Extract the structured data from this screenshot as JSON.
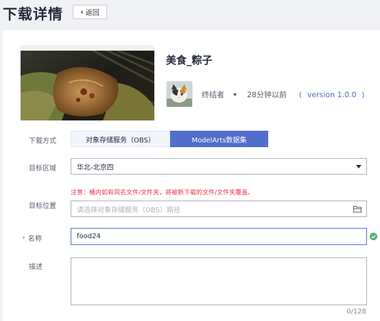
{
  "page": {
    "title": "下载详情",
    "back_label": "返回"
  },
  "dataset": {
    "title": "美食_粽子",
    "owner": "终结者",
    "separator": "•",
    "time": "28分钟以前",
    "version_open": "(",
    "version": "version 1.0.0",
    "version_close": ")"
  },
  "form": {
    "method_label": "下载方式",
    "method_options": [
      "对象存储服务（OBS）",
      "ModelArts数据集"
    ],
    "method_selected": "ModelArts数据集",
    "region_label": "目标区域",
    "region_value": "华北-北京四",
    "location_label": "目标位置",
    "location_warning": "注意：桶内如有同名文件/文件夹，将被新下载的文件/文件夹覆盖。",
    "location_placeholder": "请选择对象存储服务（OBS）路径",
    "name_required_mark": "*",
    "name_label": "名称",
    "name_value": "food24",
    "desc_label": "描述",
    "desc_value": "",
    "desc_counter": "0/128"
  },
  "colors": {
    "primary": "#526ecc",
    "warning": "#e6354b",
    "success": "#50b370",
    "required": "#f66f6a"
  },
  "icons": [
    "chevron-left-icon",
    "chevron-down-icon",
    "folder-icon",
    "check-circle-icon"
  ]
}
